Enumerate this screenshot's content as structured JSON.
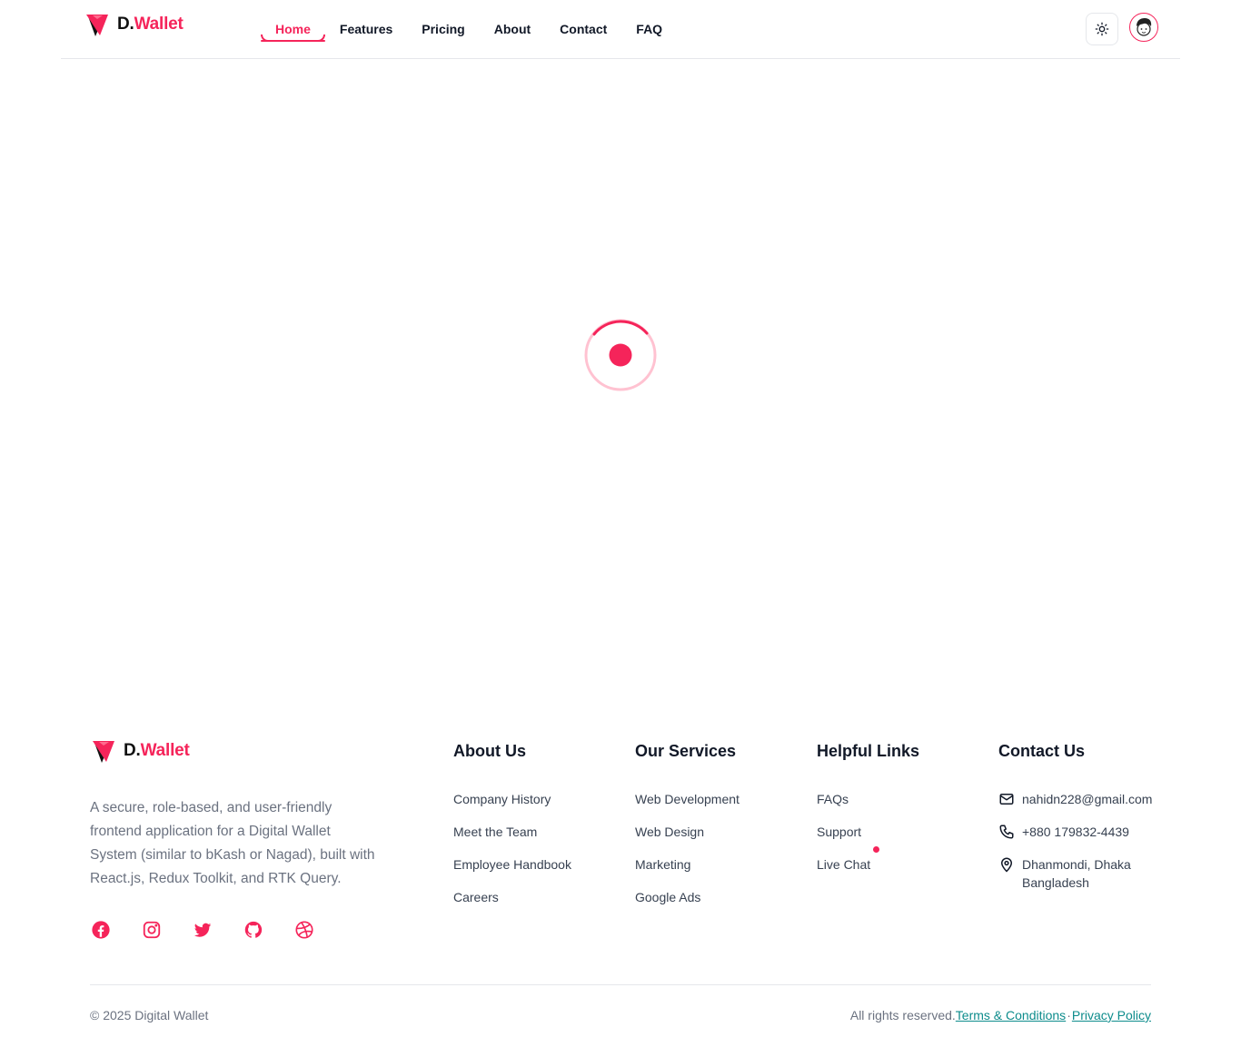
{
  "brand": {
    "prefix": "D.",
    "name": "Wallet",
    "accent": "#f5245a"
  },
  "nav": {
    "items": [
      {
        "label": "Home",
        "active": true
      },
      {
        "label": "Features"
      },
      {
        "label": "Pricing"
      },
      {
        "label": "About"
      },
      {
        "label": "Contact"
      },
      {
        "label": "FAQ"
      }
    ],
    "theme_icon": "sun-icon",
    "avatar_icon": "user-avatar"
  },
  "loading": {
    "icon": "spinner-icon"
  },
  "footer": {
    "description": "A secure, role-based, and user-friendly frontend application for a Digital Wallet System (similar to bKash or Nagad), built with React.js, Redux Toolkit, and RTK Query.",
    "socials": [
      "facebook-icon",
      "instagram-icon",
      "twitter-icon",
      "github-icon",
      "dribbble-icon"
    ],
    "about": {
      "title": "About Us",
      "links": [
        "Company History",
        "Meet the Team",
        "Employee Handbook",
        "Careers"
      ]
    },
    "services": {
      "title": "Our Services",
      "links": [
        "Web Development",
        "Web Design",
        "Marketing",
        "Google Ads"
      ]
    },
    "helpful": {
      "title": "Helpful Links",
      "links": [
        "FAQs",
        "Support",
        "Live Chat"
      ]
    },
    "contact": {
      "title": "Contact Us",
      "email": "nahidn228@gmail.com",
      "phone": "+880 179832-4439",
      "address_line1": "Dhanmondi, Dhaka",
      "address_line2": "Bangladesh"
    },
    "copyright": "© 2025 Digital Wallet",
    "rights": "All rights reserved.",
    "terms": "Terms & Conditions",
    "separator": "·",
    "privacy": "Privacy Policy"
  }
}
